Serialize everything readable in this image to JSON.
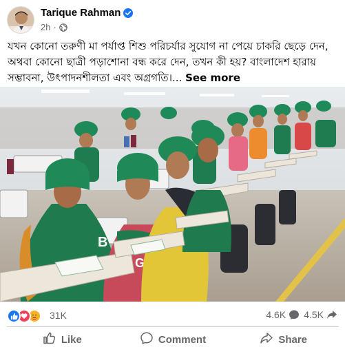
{
  "post": {
    "author": "Tarique Rahman",
    "time": "2h",
    "time_separator": "·",
    "text": "যখন কোনো তরুণী মা পর্যাপ্ত শিশু পরিচর্যার সুযোগ না পেয়ে চাকরি ছেড়ে দেন, অথবা কোনো ছাত্রী পড়াশোনা বন্ধ করে দেন, তখন কী হয়? বাংলাদেশ হারায় সম্ভাবনা, উৎপাদনশীলতা এবং অগ্রগতি।...",
    "see_more": "See more"
  },
  "photo_labels": {
    "g_letter": "G",
    "b_letter": "B"
  },
  "stats": {
    "reactions": "31K",
    "comments": "4.6K",
    "shares": "4.5K"
  },
  "actions": {
    "like": "Like",
    "comment": "Comment",
    "share": "Share"
  },
  "colors": {
    "brand_blue": "#1877f2",
    "love_red": "#f33e58",
    "care_yellow": "#f7b125",
    "secondary_text": "#65676b",
    "hijab_green": "#1e8a5a"
  }
}
